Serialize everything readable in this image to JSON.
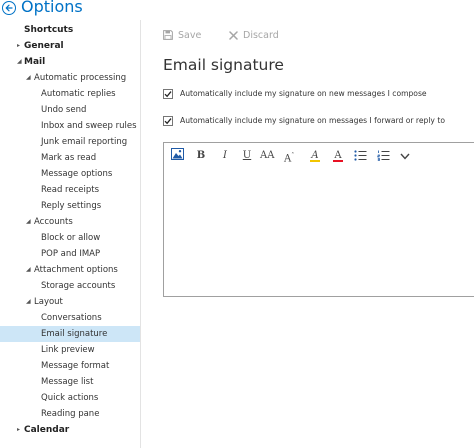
{
  "header": {
    "title": "Options"
  },
  "sidebar": {
    "items": [
      {
        "label": "Shortcuts",
        "level": 0,
        "caret": ""
      },
      {
        "label": "General",
        "level": 0,
        "caret": "▸"
      },
      {
        "label": "Mail",
        "level": 0,
        "caret": "◢"
      },
      {
        "label": "Automatic processing",
        "level": 1,
        "caret": "◢"
      },
      {
        "label": "Automatic replies",
        "level": 2,
        "caret": ""
      },
      {
        "label": "Undo send",
        "level": 2,
        "caret": ""
      },
      {
        "label": "Inbox and sweep rules",
        "level": 2,
        "caret": ""
      },
      {
        "label": "Junk email reporting",
        "level": 2,
        "caret": ""
      },
      {
        "label": "Mark as read",
        "level": 2,
        "caret": ""
      },
      {
        "label": "Message options",
        "level": 2,
        "caret": ""
      },
      {
        "label": "Read receipts",
        "level": 2,
        "caret": ""
      },
      {
        "label": "Reply settings",
        "level": 2,
        "caret": ""
      },
      {
        "label": "Accounts",
        "level": 1,
        "caret": "◢"
      },
      {
        "label": "Block or allow",
        "level": 2,
        "caret": ""
      },
      {
        "label": "POP and IMAP",
        "level": 2,
        "caret": ""
      },
      {
        "label": "Attachment options",
        "level": 1,
        "caret": "◢"
      },
      {
        "label": "Storage accounts",
        "level": 2,
        "caret": ""
      },
      {
        "label": "Layout",
        "level": 1,
        "caret": "◢"
      },
      {
        "label": "Conversations",
        "level": 2,
        "caret": ""
      },
      {
        "label": "Email signature",
        "level": 2,
        "caret": "",
        "selected": true
      },
      {
        "label": "Link preview",
        "level": 2,
        "caret": ""
      },
      {
        "label": "Message format",
        "level": 2,
        "caret": ""
      },
      {
        "label": "Message list",
        "level": 2,
        "caret": ""
      },
      {
        "label": "Quick actions",
        "level": 2,
        "caret": ""
      },
      {
        "label": "Reading pane",
        "level": 2,
        "caret": ""
      },
      {
        "label": "Calendar",
        "level": 0,
        "caret": "▸"
      }
    ]
  },
  "toolbar": {
    "save_label": "Save",
    "discard_label": "Discard"
  },
  "main": {
    "heading": "Email signature",
    "option_new": "Automatically include my signature on new messages I compose",
    "option_forward": "Automatically include my signature on messages I forward or reply to"
  },
  "editor": {
    "bold": "B",
    "italic": "I",
    "underline": "U",
    "font_size": "AA",
    "grow_font": "A",
    "highlight": "A",
    "font_color": "A",
    "value": ""
  },
  "colors": {
    "accent": "#0072c6",
    "selected_background": "#cde6f7",
    "disabled_text": "#a6a6a6",
    "highlight_bar": "#f2c500",
    "font_color_bar": "#e81123"
  }
}
